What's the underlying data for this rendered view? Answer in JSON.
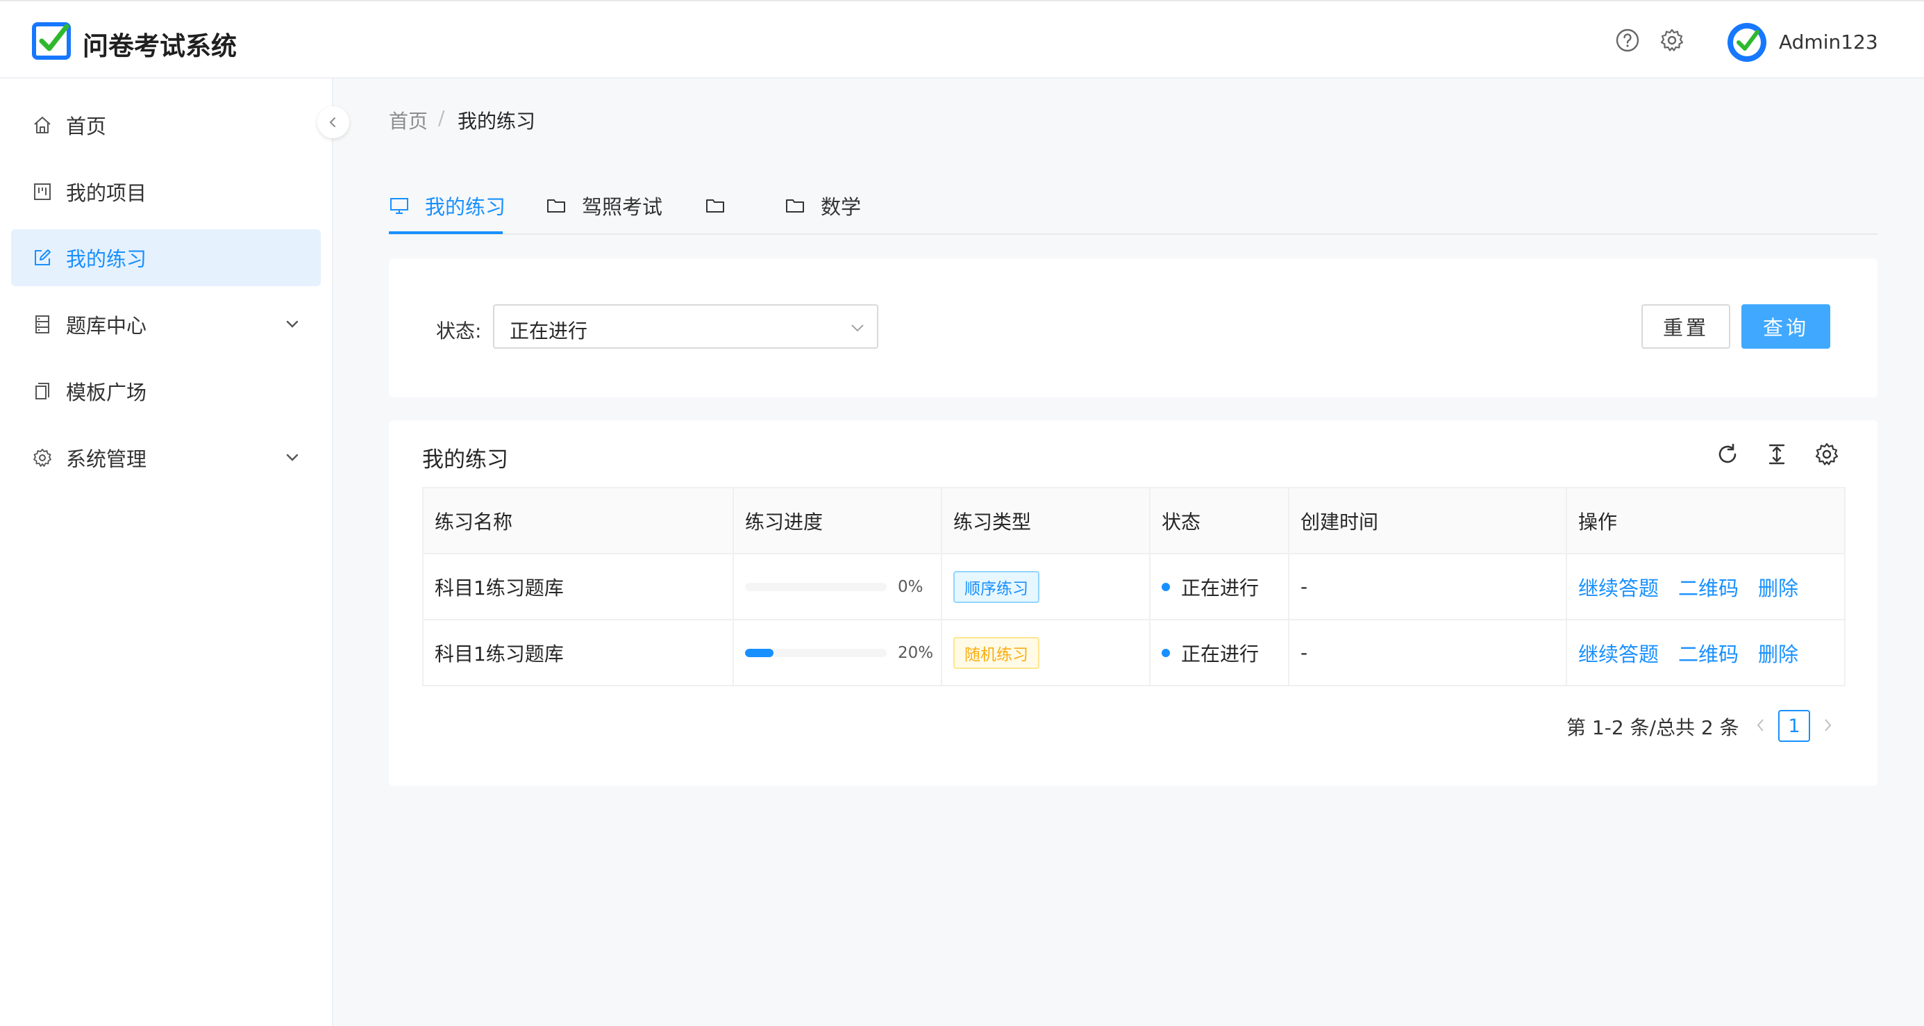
{
  "app": {
    "title": "问卷考试系统"
  },
  "header": {
    "username": "Admin123",
    "help_icon": "help-icon",
    "settings_icon": "gear-icon"
  },
  "sidebar": {
    "items": [
      {
        "label": "首页",
        "icon": "home-icon"
      },
      {
        "label": "我的项目",
        "icon": "project-icon"
      },
      {
        "label": "我的练习",
        "icon": "edit-icon",
        "active": true
      },
      {
        "label": "题库中心",
        "icon": "database-icon",
        "expandable": true
      },
      {
        "label": "模板广场",
        "icon": "template-icon"
      },
      {
        "label": "系统管理",
        "icon": "gear-icon",
        "expandable": true
      }
    ]
  },
  "breadcrumb": {
    "home": "首页",
    "separator": "/",
    "current": "我的练习"
  },
  "tabs": [
    {
      "label": "我的练习",
      "icon": "desktop-icon",
      "active": true
    },
    {
      "label": "驾照考试",
      "icon": "folder-icon"
    },
    {
      "label": "",
      "icon": "folder-icon"
    },
    {
      "label": "数学",
      "icon": "folder-icon"
    }
  ],
  "filter": {
    "status_label": "状态:",
    "status_value": "正在进行",
    "reset_label": "重置",
    "query_label": "查询"
  },
  "table": {
    "title": "我的练习",
    "columns": [
      "练习名称",
      "练习进度",
      "练习类型",
      "状态",
      "创建时间",
      "操作"
    ],
    "rows": [
      {
        "name": "科目1练习题库",
        "progress": 0,
        "progress_text": "0%",
        "type": "顺序练习",
        "type_color": "blue",
        "status": "正在进行",
        "created": "-",
        "actions": [
          "继续答题",
          "二维码",
          "删除"
        ]
      },
      {
        "name": "科目1练习题库",
        "progress": 20,
        "progress_text": "20%",
        "type": "随机练习",
        "type_color": "gold",
        "status": "正在进行",
        "created": "-",
        "actions": [
          "继续答题",
          "二维码",
          "删除"
        ]
      }
    ]
  },
  "pagination": {
    "total_text": "第 1-2 条/总共 2 条",
    "current_page": "1"
  },
  "colors": {
    "primary": "#1890ff",
    "query_button": "#40a9ff",
    "active_menu_bg": "#e6f1fe"
  }
}
